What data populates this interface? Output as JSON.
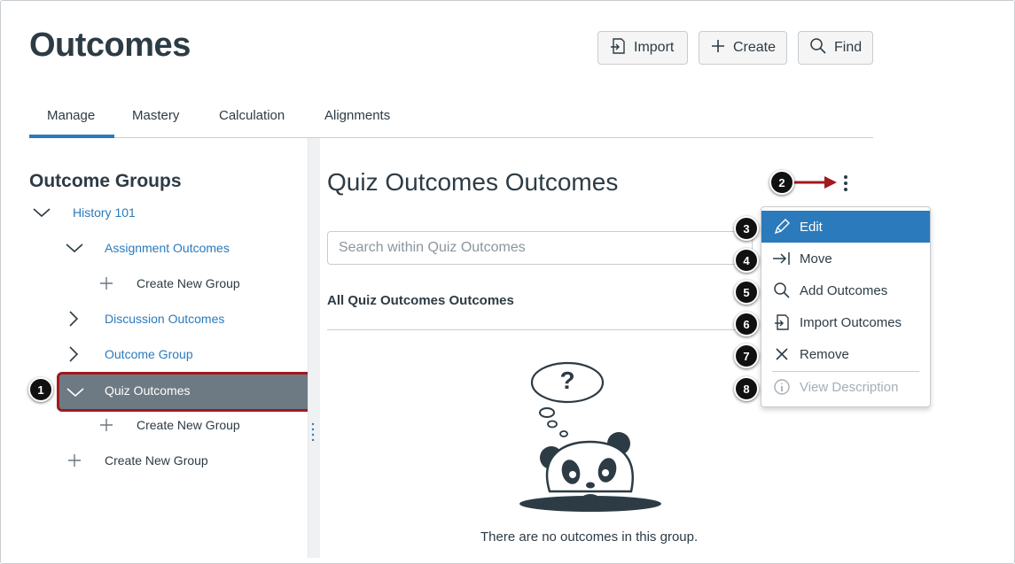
{
  "page": {
    "title": "Outcomes"
  },
  "header_buttons": {
    "import": "Import",
    "create": "Create",
    "find": "Find"
  },
  "tabs": [
    {
      "label": "Manage",
      "active": true
    },
    {
      "label": "Mastery"
    },
    {
      "label": "Calculation"
    },
    {
      "label": "Alignments"
    }
  ],
  "sidebar": {
    "title": "Outcome Groups",
    "tree": [
      {
        "label": "History 101",
        "expanded": true
      },
      {
        "label": "Assignment Outcomes",
        "expanded": true
      },
      {
        "label": "Create New Group"
      },
      {
        "label": "Discussion Outcomes",
        "expanded": false
      },
      {
        "label": "Outcome Group",
        "expanded": false
      },
      {
        "label": "Quiz Outcomes",
        "expanded": true,
        "selected": true
      },
      {
        "label": "Create New Group"
      },
      {
        "label": "Create New Group"
      }
    ]
  },
  "main": {
    "title": "Quiz Outcomes Outcomes",
    "search_placeholder": "Search within Quiz Outcomes",
    "list_heading": "All Quiz Outcomes Outcomes",
    "empty_bubble": "?",
    "empty_text": "There are no outcomes in this group."
  },
  "menu": {
    "items": [
      {
        "label": "Edit",
        "icon": "pencil-icon",
        "active": true
      },
      {
        "label": "Move",
        "icon": "move-arrow-icon"
      },
      {
        "label": "Add Outcomes",
        "icon": "search-icon"
      },
      {
        "label": "Import Outcomes",
        "icon": "import-icon"
      },
      {
        "label": "Remove",
        "icon": "x-icon"
      },
      {
        "label": "View Description",
        "icon": "info-icon",
        "disabled": true
      }
    ]
  },
  "callouts": [
    "1",
    "2",
    "3",
    "4",
    "5",
    "6",
    "7",
    "8"
  ],
  "colors": {
    "link": "#2b7abc",
    "menu_active": "#2b7abc",
    "selected_row": "#6e7a83",
    "highlight_border": "#a01a1e",
    "arrow": "#a01a1e"
  }
}
